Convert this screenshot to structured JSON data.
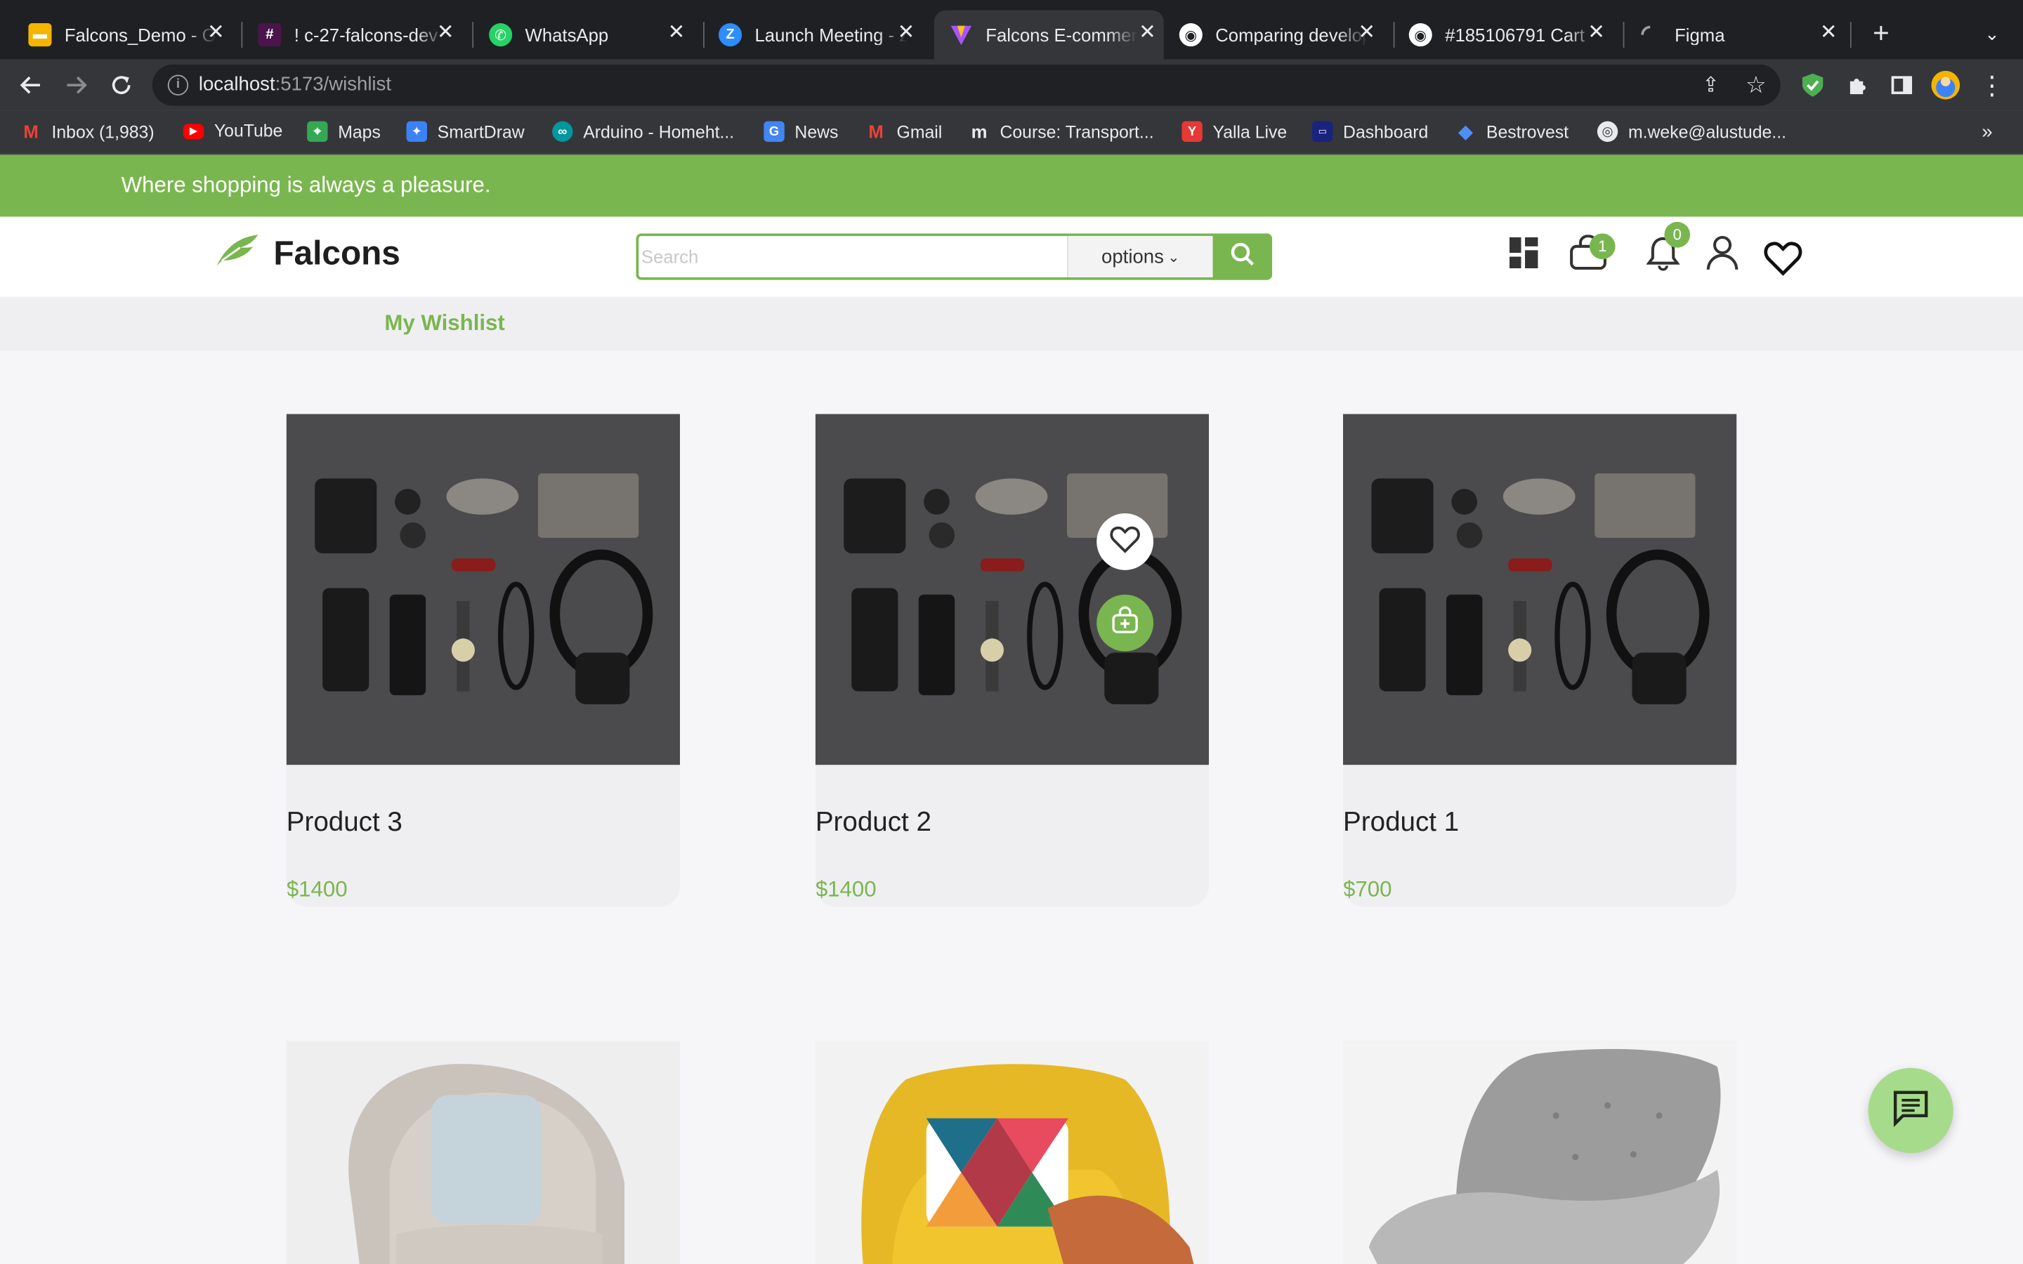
{
  "browser": {
    "tabs": [
      {
        "title": "Falcons_Demo - Google Slides",
        "icon": "slides-icon",
        "color": "#f4b400"
      },
      {
        "title": "! c-27-falcons-dev",
        "icon": "slack-icon",
        "color": "#e01e5a"
      },
      {
        "title": "WhatsApp",
        "icon": "whatsapp-icon",
        "color": "#25d366"
      },
      {
        "title": "Launch Meeting - Zoom",
        "icon": "zoom-icon",
        "color": "#2d8cff"
      },
      {
        "title": "Falcons E-commerce",
        "icon": "vite-icon",
        "color": "#a855f7"
      },
      {
        "title": "Comparing develop",
        "icon": "github-icon",
        "color": "#ffffff"
      },
      {
        "title": "#185106791 Cart",
        "icon": "github-icon",
        "color": "#ffffff"
      },
      {
        "title": "Figma",
        "icon": "loading-icon",
        "color": "#9aa0a6"
      }
    ],
    "url_host": "localhost",
    "url_rest": ":5173/wishlist",
    "bookmarks": [
      {
        "label": "Inbox (1,983)",
        "icon": "gmail-icon",
        "color": "#ea4335"
      },
      {
        "label": "YouTube",
        "icon": "youtube-icon",
        "color": "#ff0000"
      },
      {
        "label": "Maps",
        "icon": "maps-icon",
        "color": "#34a853"
      },
      {
        "label": "SmartDraw",
        "icon": "smartdraw-icon",
        "color": "#3b82f6"
      },
      {
        "label": "Arduino - Homeht...",
        "icon": "arduino-icon",
        "color": "#00979d"
      },
      {
        "label": "News",
        "icon": "news-icon",
        "color": "#4285f4"
      },
      {
        "label": "Gmail",
        "icon": "gmail-icon",
        "color": "#ea4335"
      },
      {
        "label": "Course: Transport...",
        "icon": "moodle-icon",
        "color": "#f98012"
      },
      {
        "label": "Yalla Live",
        "icon": "yalla-icon",
        "color": "#e53935"
      },
      {
        "label": "Dashboard",
        "icon": "dashboard-icon",
        "color": "#1a237e"
      },
      {
        "label": "Bestrovest",
        "icon": "diamond-icon",
        "color": "#4f8ef7"
      },
      {
        "label": "m.weke@alustude...",
        "icon": "globe-icon",
        "color": "#e8eaed"
      }
    ],
    "more_bookmarks": "»"
  },
  "promo": {
    "text": "Where shopping is always a pleasure."
  },
  "header": {
    "brand": "Falcons",
    "search_placeholder": "Search",
    "options_label": "options",
    "cart_count": "1",
    "notification_count": "0"
  },
  "subnav": {
    "title": "My Wishlist"
  },
  "products": [
    {
      "name": "Product 3",
      "price": "$1400"
    },
    {
      "name": "Product 2",
      "price": "$1400"
    },
    {
      "name": "Product 1",
      "price": "$700"
    }
  ],
  "colors": {
    "brand_green": "#7ab64f",
    "chat_green": "#a7db8c"
  }
}
